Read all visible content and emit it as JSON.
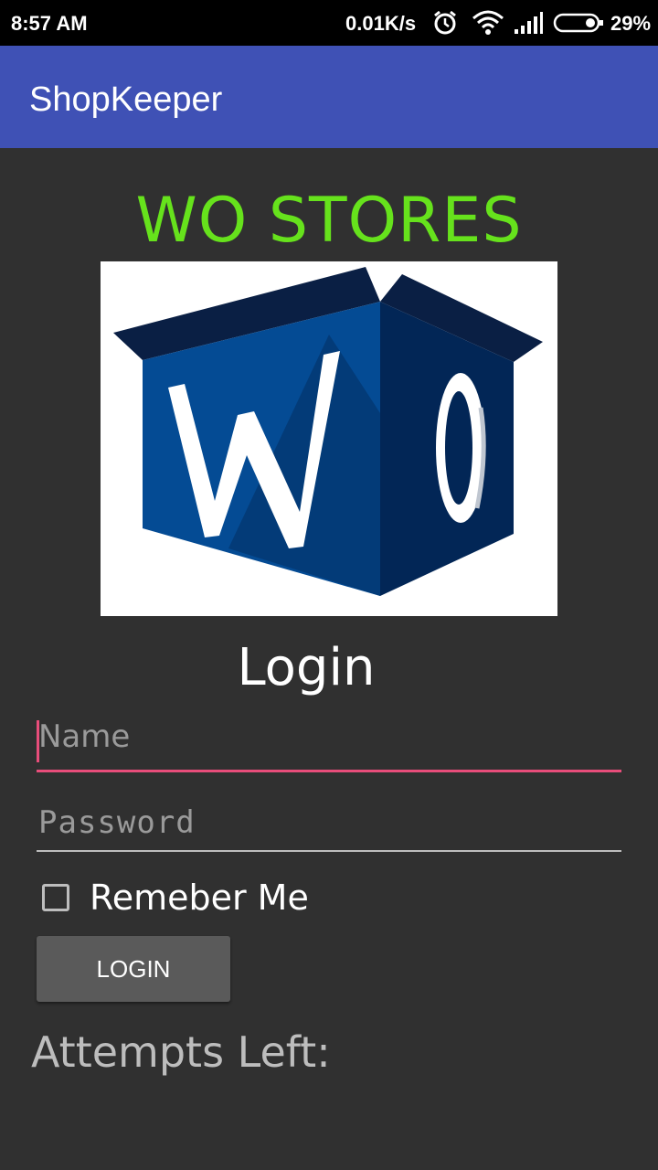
{
  "status_bar": {
    "time": "8:57 AM",
    "network_speed": "0.01K/s",
    "battery_percent": "29%",
    "icons": [
      "alarm-icon",
      "wifi-icon",
      "signal-icon",
      "battery-icon"
    ]
  },
  "app_bar": {
    "title": "ShopKeeper"
  },
  "store": {
    "name": "WO STORES",
    "name_color": "#66e21c",
    "logo_letters": "WO"
  },
  "login": {
    "heading": "Login",
    "name_placeholder": "Name",
    "name_value": "",
    "password_placeholder": "Password",
    "password_value": "",
    "remember_label": "Remeber Me",
    "remember_checked": false,
    "button_label": "LOGIN",
    "attempts_label": "Attempts Left:"
  },
  "colors": {
    "app_bar": "#3f51b5",
    "background": "#303030",
    "accent": "#e84d7a"
  }
}
